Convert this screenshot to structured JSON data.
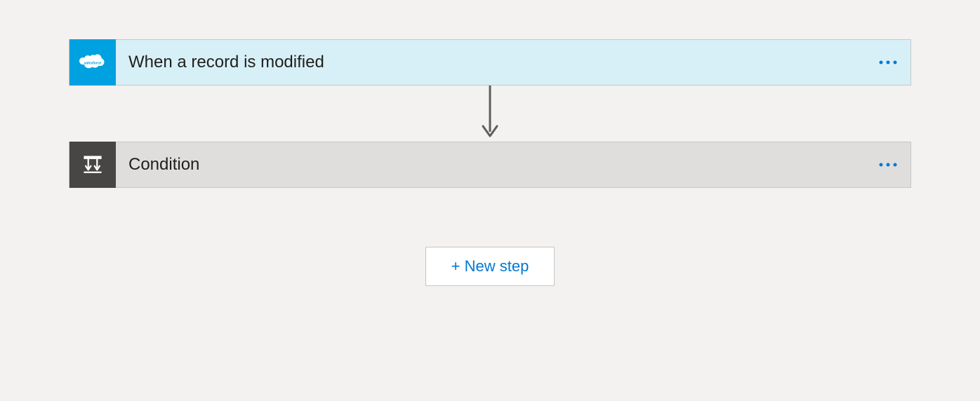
{
  "flow": {
    "steps": [
      {
        "title": "When a record is modified",
        "type": "trigger",
        "icon": "salesforce"
      },
      {
        "title": "Condition",
        "type": "condition",
        "icon": "condition"
      }
    ]
  },
  "actions": {
    "new_step_label": "+ New step"
  }
}
